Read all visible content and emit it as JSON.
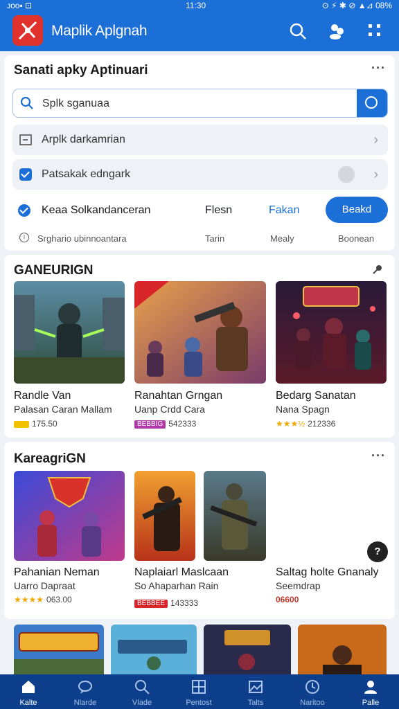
{
  "statusbar": {
    "left": "ᴊᴏᴏ▪ ⊡",
    "time": "11:30",
    "right": "⊙ ⚡ ✱ ⊘ ▲⊿ 08%"
  },
  "appbar": {
    "title": "Maplik Aplgnah"
  },
  "card": {
    "title": "Sanati apky Aptinuari",
    "search_value": "Splk sganuaa",
    "row1_label": "Arplk darkamrian",
    "row2_label": "Patsakak edngark",
    "option_label": "Keaa Solkandanceran",
    "option_col1": "Flesn",
    "option_col2": "Fakan",
    "option_button": "Beakd",
    "info_text": "Srghario ubinnoantara",
    "info_col1": "Tarin",
    "info_col2": "Mealy",
    "info_col3": "Boonean"
  },
  "section1": {
    "title": "GANEURIGN",
    "games": [
      {
        "title": "Randle Van",
        "sub": "Palasan Caran Mallam",
        "badge": "",
        "meta": "175.50"
      },
      {
        "title": "Ranahtan Grngan",
        "sub": "Uanp Crdd Cara",
        "badge": "BEBBIG",
        "meta": "542333"
      },
      {
        "title": "Bedarg Sanatan",
        "sub": "Nana Spagn",
        "stars": "★★★½",
        "meta": "212336"
      }
    ]
  },
  "section2": {
    "title": "KareagriGN",
    "games": [
      {
        "title": "Pahanian Neman",
        "sub": "Uarro Dapraat",
        "stars": "★★★★",
        "meta": "063.00"
      },
      {
        "title": "Naplaiarl Maslcaan",
        "sub": "So Ahaparhan Rain",
        "badge": "BEBBEE",
        "meta": "143333"
      },
      {
        "title": "Saltag holte Gnanaly",
        "sub": "Seemdrap",
        "meta": "06600"
      }
    ]
  },
  "bottom_nav": [
    {
      "label": "Kalte",
      "icon": "home-icon",
      "active": true
    },
    {
      "label": "Nlarde",
      "icon": "chat-icon"
    },
    {
      "label": "Vlade",
      "icon": "search-icon"
    },
    {
      "label": "Pentost",
      "icon": "grid-icon"
    },
    {
      "label": "Talts",
      "icon": "image-icon"
    },
    {
      "label": "Naritoo",
      "icon": "clock-icon"
    },
    {
      "label": "Palle",
      "icon": "profile-icon"
    }
  ],
  "colors": {
    "primary": "#1c6fd6",
    "nav_bg": "#0d3f8c",
    "logo_red": "#e0322c"
  }
}
